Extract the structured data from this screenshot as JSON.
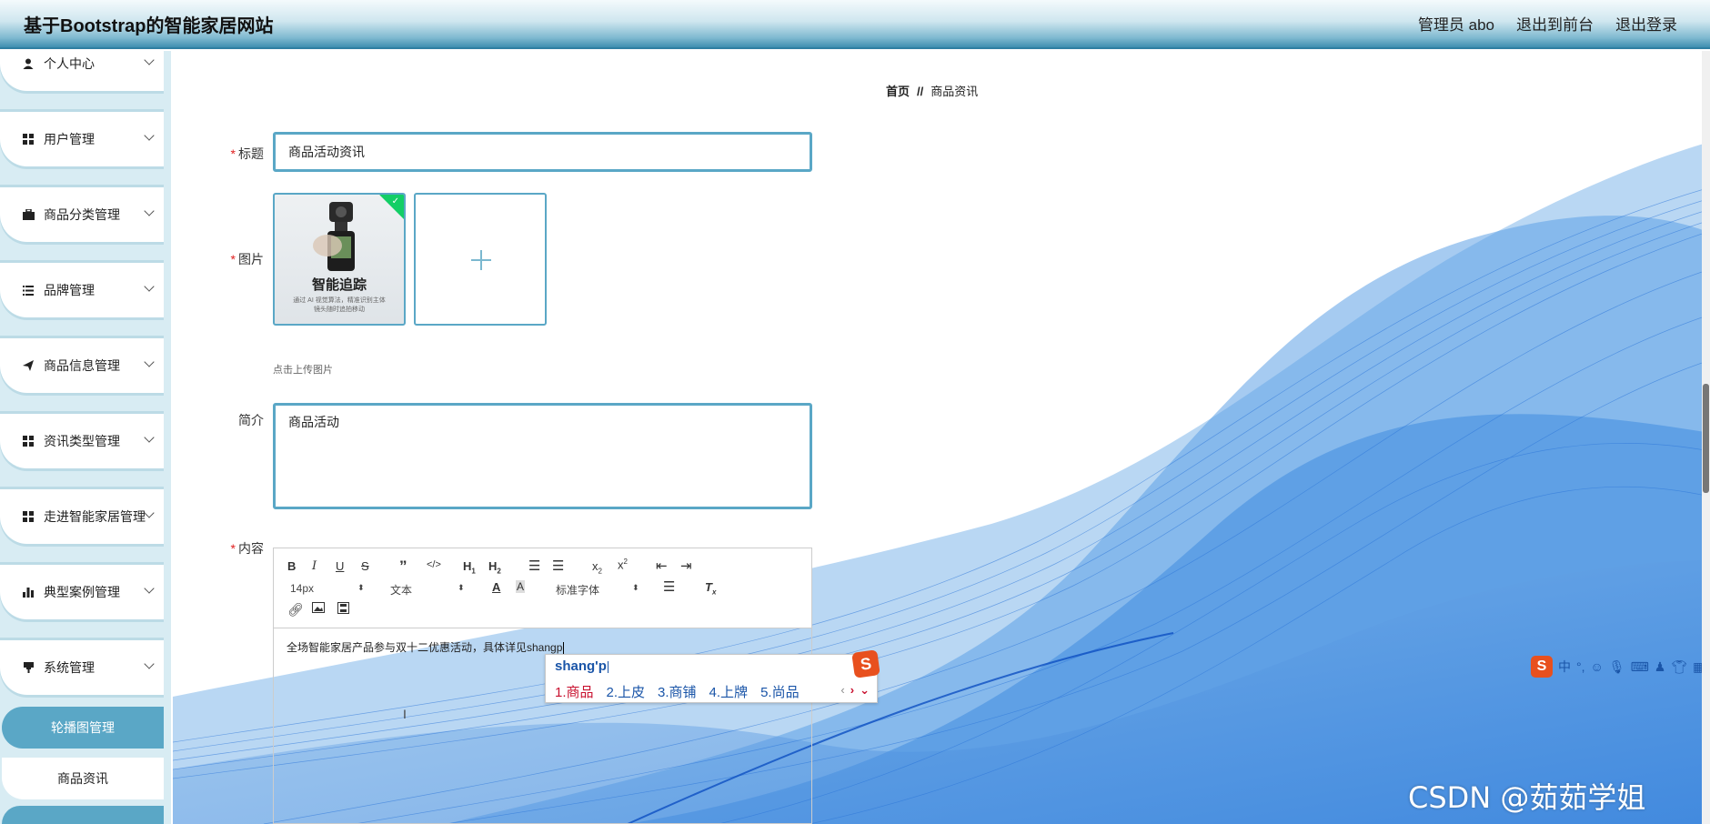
{
  "header": {
    "site_title": "基于Bootstrap的智能家居网站",
    "admin_label": "管理员 abo",
    "to_front_label": "退出到前台",
    "logout_label": "退出登录"
  },
  "sidebar": {
    "items": [
      {
        "label": "个人中心",
        "icon": "person-icon"
      },
      {
        "label": "用户管理",
        "icon": "grid-icon"
      },
      {
        "label": "商品分类管理",
        "icon": "briefcase-icon"
      },
      {
        "label": "品牌管理",
        "icon": "list-icon"
      },
      {
        "label": "商品信息管理",
        "icon": "send-icon"
      },
      {
        "label": "资讯类型管理",
        "icon": "grid-icon"
      },
      {
        "label": "走进智能家居管理",
        "icon": "grid-icon"
      },
      {
        "label": "典型案例管理",
        "icon": "bar-chart-icon"
      },
      {
        "label": "系统管理",
        "icon": "tag-icon"
      }
    ],
    "sub_items": [
      {
        "label": "轮播图管理",
        "active": true
      },
      {
        "label": "商品资讯",
        "active": false
      }
    ]
  },
  "breadcrumb": {
    "home": "首页",
    "separator": "//",
    "current": "商品资讯"
  },
  "form": {
    "title_label": "标题",
    "title_value": "商品活动资讯",
    "image_label": "图片",
    "image_thumb_title": "智能追踪",
    "image_thumb_sub": "通过 AI 视觉算法，精准识别主体\n镜头随时追拍移动",
    "upload_hint": "点击上传图片",
    "intro_label": "简介",
    "intro_value": "商品活动",
    "content_label": "内容",
    "required_mark": "*"
  },
  "editor": {
    "font_size": "14px",
    "paragraph": "文本",
    "font_family": "标准字体",
    "content_text": "全场智能家居产品参与双十二优惠活动，具体详见shangp"
  },
  "ime": {
    "input": "shang'p",
    "candidates": [
      "1.商品",
      "2.上皮",
      "3.商铺",
      "4.上牌",
      "5.尚品"
    ],
    "logo": "S",
    "status_chars": [
      "中",
      "°,"
    ]
  },
  "watermark": "CSDN @茹茹学姐",
  "colors": {
    "accent": "#5aa7c6",
    "required": "#e02020",
    "ime_blue": "#1a55a8",
    "ime_red": "#c8102e"
  }
}
